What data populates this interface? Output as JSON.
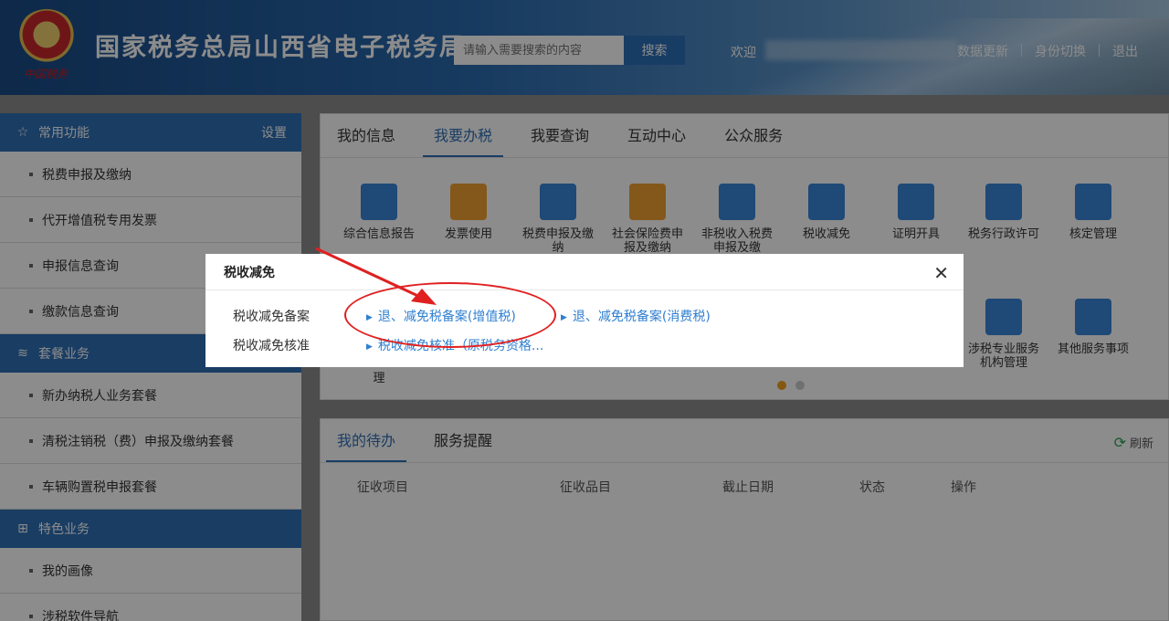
{
  "header": {
    "emblem_text": "中国税务",
    "site_title": "国家税务总局山西省电子税务局",
    "search_placeholder": "请输入需要搜索的内容",
    "search_button": "搜索",
    "welcome": "欢迎",
    "links": [
      "数据更新",
      "身份切换",
      "退出"
    ]
  },
  "sidebar": {
    "sections": [
      {
        "title": "常用功能",
        "icon": "star-icon",
        "right": "设置",
        "items": [
          "税费申报及缴纳",
          "代开增值税专用发票",
          "申报信息查询",
          "缴款信息查询"
        ]
      },
      {
        "title": "套餐业务",
        "icon": "layers-icon",
        "right": "",
        "items": [
          "新办纳税人业务套餐",
          "清税注销税（费）申报及缴纳套餐",
          "车辆购置税申报套餐"
        ]
      },
      {
        "title": "特色业务",
        "icon": "grid-icon",
        "right": "",
        "items": [
          "我的画像",
          "涉税软件导航"
        ]
      }
    ]
  },
  "main": {
    "tabs": [
      "我的信息",
      "我要办税",
      "我要查询",
      "互动中心",
      "公众服务"
    ],
    "active_tab": "我要办税",
    "grid_items": [
      {
        "label": "综合信息报告",
        "icon": "clipboard-icon",
        "color": "#3a86d8"
      },
      {
        "label": "发票使用",
        "icon": "invoice-icon",
        "color": "#f0a030"
      },
      {
        "label": "税费申报及缴纳",
        "icon": "wallet-icon",
        "color": "#3a86d8"
      },
      {
        "label": "社会保险费申报及缴纳",
        "icon": "calendar-icon",
        "color": "#f0a030"
      },
      {
        "label": "非税收入税费申报及缴",
        "icon": "layout-icon",
        "color": "#3a86d8"
      },
      {
        "label": "税收减免",
        "icon": "documents-icon",
        "color": "#3a86d8"
      },
      {
        "label": "证明开具",
        "icon": "certificate-icon",
        "color": "#3a86d8"
      },
      {
        "label": "税务行政许可",
        "icon": "shield-icon",
        "color": "#3a86d8"
      },
      {
        "label": "核定管理",
        "icon": "pie-chart-icon",
        "color": "#3a86d8"
      },
      {
        "label": "涉税专业服务机构管理",
        "icon": "briefcase-icon",
        "color": "#3a86d8"
      },
      {
        "label": "其他服务事项",
        "icon": "search-doc-icon",
        "color": "#3a86d8"
      }
    ],
    "row2_partial_labels": [
      "理"
    ]
  },
  "todo": {
    "tabs": [
      "我的待办",
      "服务提醒"
    ],
    "refresh": "刷新",
    "columns": [
      "征收项目",
      "征收品目",
      "截止日期",
      "状态",
      "操作"
    ]
  },
  "modal": {
    "title": "税收减免",
    "rows": [
      {
        "label": "税收减免备案",
        "links": [
          "退、减免税备案(增值税)",
          "退、减免税备案(消费税)"
        ]
      },
      {
        "label": "税收减免核准",
        "links": [
          "税收减免核准（原税务资格..."
        ]
      }
    ]
  }
}
